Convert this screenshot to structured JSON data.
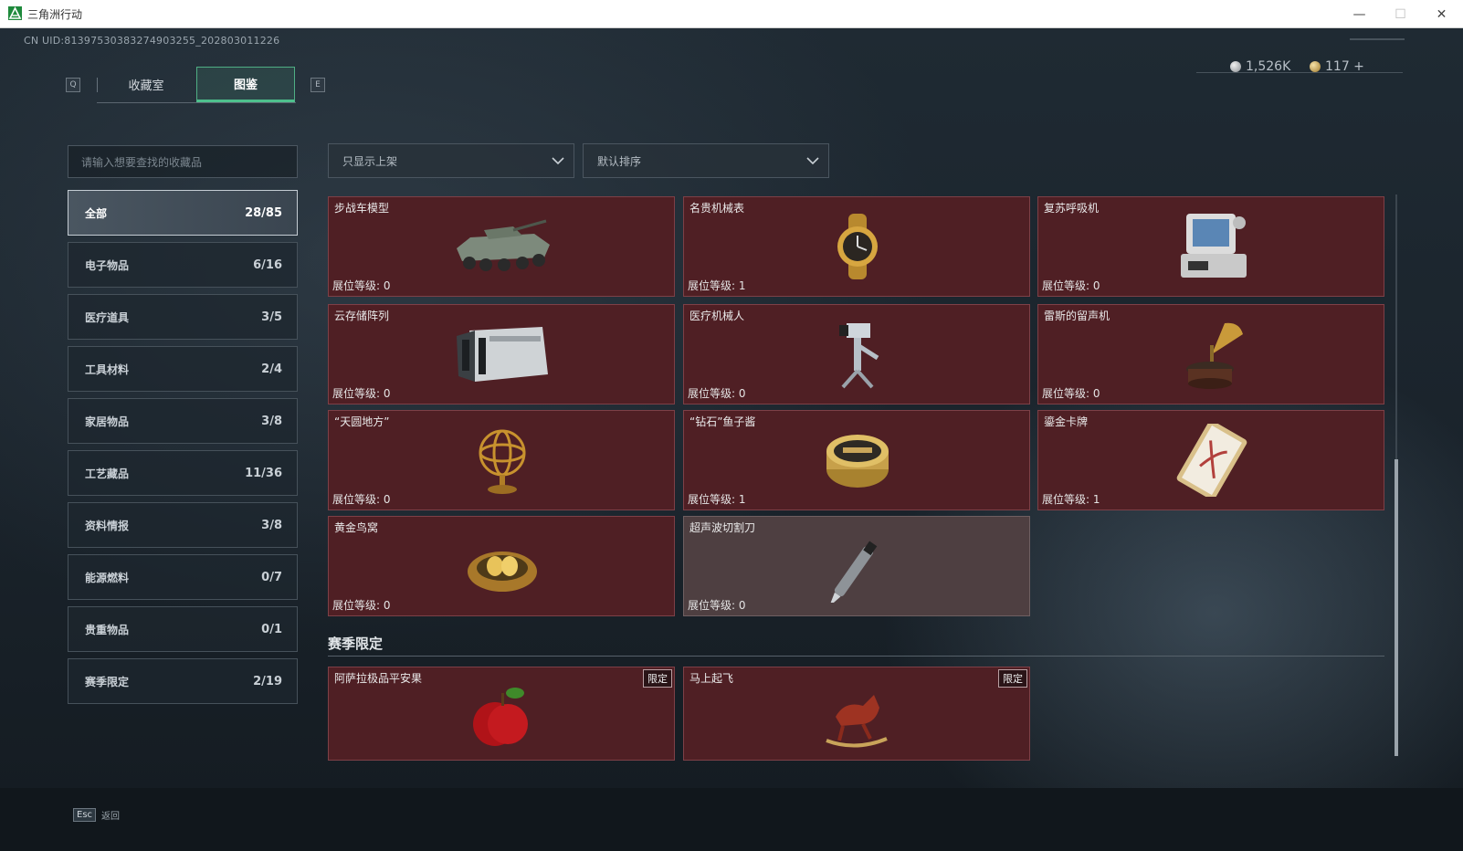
{
  "window": {
    "title": "三角洲行动",
    "minimize": "—",
    "maximize": "☐",
    "close": "✕"
  },
  "header": {
    "uid": "CN UID:8139753038327490325​5_202803011226",
    "tab_prev_key": "Q",
    "tab_next_key": "E",
    "tabs": [
      {
        "label": "收藏室",
        "active": false
      },
      {
        "label": "图鉴",
        "active": true
      }
    ],
    "currency": [
      {
        "icon": "silver-coin-icon",
        "value": "1,526K"
      },
      {
        "icon": "gold-coin-icon",
        "value": "117 +"
      }
    ]
  },
  "sidebar": {
    "search_placeholder": "请输入想要查找的收藏品",
    "categories": [
      {
        "label": "全部",
        "count": "28/85",
        "active": true
      },
      {
        "label": "电子物品",
        "count": "6/16"
      },
      {
        "label": "医疗道具",
        "count": "3/5"
      },
      {
        "label": "工具材料",
        "count": "2/4"
      },
      {
        "label": "家居物品",
        "count": "3/8"
      },
      {
        "label": "工艺藏品",
        "count": "11/36"
      },
      {
        "label": "资料情报",
        "count": "3/8"
      },
      {
        "label": "能源燃料",
        "count": "0/7"
      },
      {
        "label": "贵重物品",
        "count": "0/1"
      },
      {
        "label": "赛季限定",
        "count": "2/19"
      }
    ]
  },
  "filters": {
    "shelf_filter": "只显示上架",
    "sort": "默认排序"
  },
  "items": [
    {
      "name": "步战车模型",
      "level_label": "展位等级:",
      "level": "0",
      "icon": "armored-vehicle-icon"
    },
    {
      "name": "名贵机械表",
      "level_label": "展位等级:",
      "level": "1",
      "icon": "watch-icon"
    },
    {
      "name": "复苏呼吸机",
      "level_label": "展位等级:",
      "level": "0",
      "icon": "ventilator-icon"
    },
    {
      "name": "云存储阵列",
      "level_label": "展位等级:",
      "level": "0",
      "icon": "storage-array-icon"
    },
    {
      "name": "医疗机械人",
      "level_label": "展位等级:",
      "level": "0",
      "icon": "medical-robot-icon"
    },
    {
      "name": "雷斯的留声机",
      "level_label": "展位等级:",
      "level": "0",
      "icon": "gramophone-icon"
    },
    {
      "name": "“天圆地方”",
      "level_label": "展位等级:",
      "level": "0",
      "icon": "armillary-sphere-icon"
    },
    {
      "name": "“钻石”鱼子酱",
      "level_label": "展位等级:",
      "level": "1",
      "icon": "caviar-tin-icon"
    },
    {
      "name": "鎏金卡牌",
      "level_label": "展位等级:",
      "level": "1",
      "icon": "gold-card-icon"
    },
    {
      "name": "黄金鸟窝",
      "level_label": "展位等级:",
      "level": "0",
      "icon": "golden-nest-icon"
    },
    {
      "name": "超声波切割刀",
      "level_label": "展位等级:",
      "level": "0",
      "icon": "ultrasonic-knife-icon"
    }
  ],
  "season_section": {
    "title": "赛季限定",
    "items": [
      {
        "name": "阿萨拉极品平安果",
        "badge": "限定",
        "icon": "apple-icon"
      },
      {
        "name": "马上起飞",
        "badge": "限定",
        "icon": "rocking-horse-icon"
      }
    ]
  },
  "footer": {
    "esc_key": "Esc",
    "back_label": "返回"
  }
}
